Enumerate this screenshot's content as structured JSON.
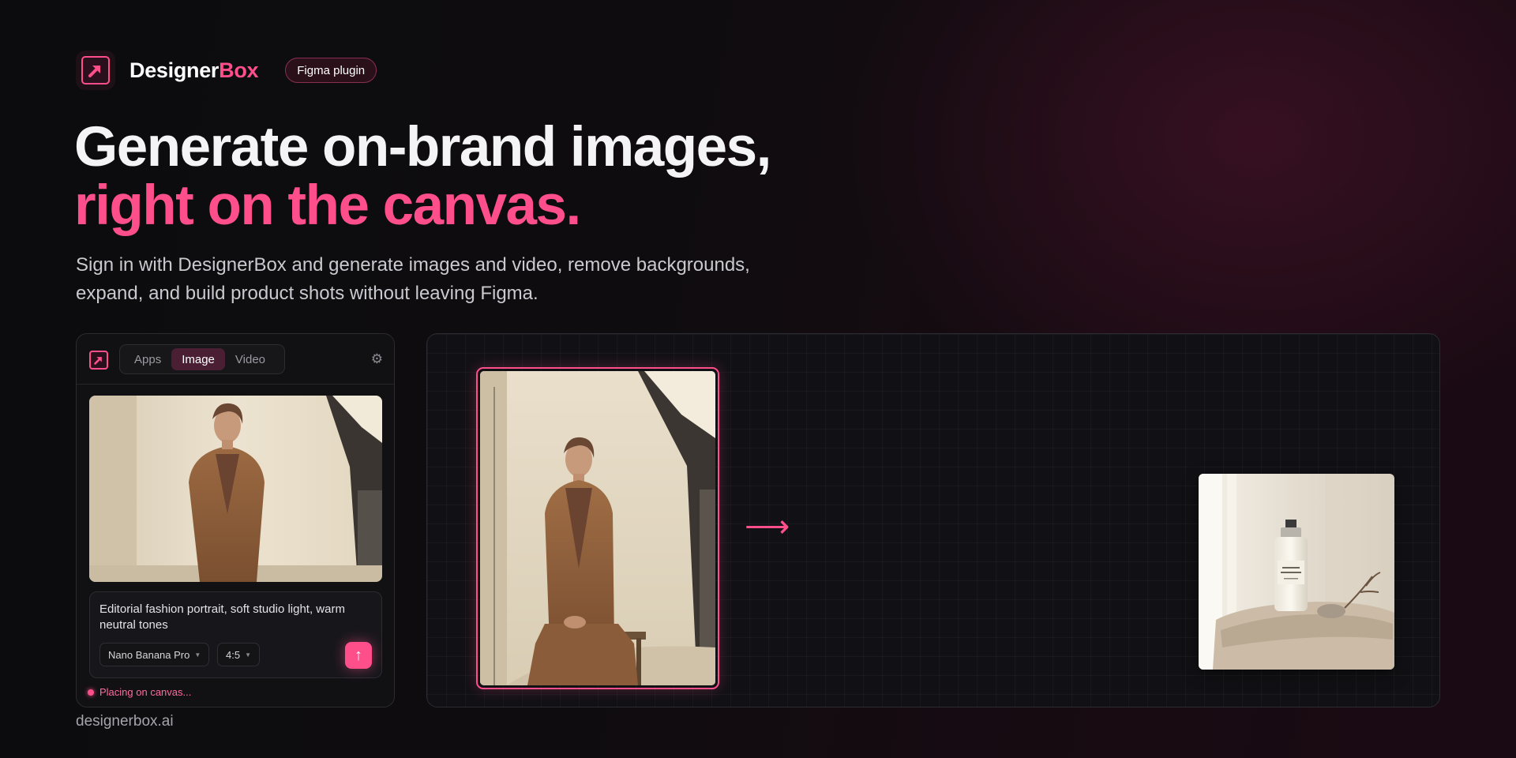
{
  "brand": {
    "name_main": "Designer",
    "name_accent": "Box",
    "badge": "Figma plugin"
  },
  "hero": {
    "headline_line1": "Generate on-brand images,",
    "headline_line2": "right on the canvas.",
    "subline": "Sign in with DesignerBox and generate images and video, remove backgrounds, expand, and build product shots without leaving Figma."
  },
  "panel": {
    "tabs": [
      {
        "label": "Apps",
        "active": false
      },
      {
        "label": "Image",
        "active": true
      },
      {
        "label": "Video",
        "active": false
      }
    ],
    "prompt": "Editorial fashion portrait, soft studio light, warm neutral tones",
    "model_select": "Nano Banana Pro",
    "ratio_select": "4:5",
    "status": "Placing on canvas..."
  },
  "canvas": {
    "arrow": "⟶"
  },
  "icons": {
    "logo": "arrow-up-right-icon",
    "settings": "gear-icon",
    "send": "arrow-up-icon",
    "caret": "chevron-down-icon"
  },
  "colors": {
    "accent": "#ff4f8b",
    "background": "#0c0c0e",
    "panel": "#111114"
  },
  "footer": {
    "domain": "designerbox.ai"
  }
}
